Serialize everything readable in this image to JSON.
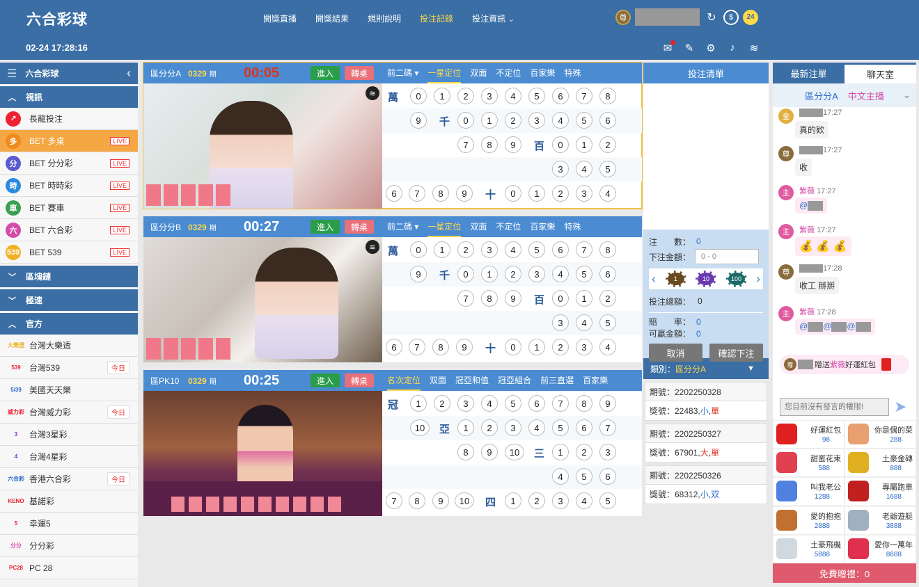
{
  "header": {
    "logo": "六合彩球",
    "datetime": "02-24 17:28:16",
    "nav": [
      "開獎直播",
      "開獎結果",
      "規則說明",
      "投注記錄",
      "投注資訊"
    ],
    "badge": "尊",
    "icon_24": "24"
  },
  "sidebar": {
    "title": "六合彩球",
    "sections": {
      "video": "視訊",
      "blockchain": "區塊鏈",
      "speed": "極速",
      "official": "官方"
    },
    "video_items": [
      {
        "label": "長龍投注",
        "icon": "",
        "color": "#e23"
      },
      {
        "label": "BET 多桌",
        "icon": "多",
        "color": "#f08a1c",
        "live": "LIVE"
      },
      {
        "label": "BET 分分彩",
        "icon": "分",
        "color": "#5a5ad0",
        "live": "LIVE"
      },
      {
        "label": "BET 時時彩",
        "icon": "時",
        "color": "#2a8ae0",
        "live": "LIVE"
      },
      {
        "label": "BET 賽車",
        "icon": "車",
        "color": "#3aa050",
        "live": "LIVE"
      },
      {
        "label": "BET 六合彩",
        "icon": "六",
        "color": "#d44ca8",
        "live": "LIVE"
      },
      {
        "label": "BET 539",
        "icon": "539",
        "color": "#f0b020",
        "live": "LIVE"
      }
    ],
    "official_items": [
      {
        "label": "台灣大樂透",
        "logo": "大樂透",
        "today": ""
      },
      {
        "label": "台灣539",
        "logo": "539",
        "today": "今日"
      },
      {
        "label": "美國天天樂",
        "logo": "5/39",
        "today": ""
      },
      {
        "label": "台灣威力彩",
        "logo": "威力彩",
        "today": "今日"
      },
      {
        "label": "台灣3星彩",
        "logo": "3",
        "today": ""
      },
      {
        "label": "台灣4星彩",
        "logo": "4",
        "today": ""
      },
      {
        "label": "香港六合彩",
        "logo": "六合彩",
        "today": "今日"
      },
      {
        "label": "基諾彩",
        "logo": "KENO",
        "today": ""
      },
      {
        "label": "幸運5",
        "logo": "5",
        "today": ""
      },
      {
        "label": "分分彩",
        "logo": "分分",
        "today": ""
      },
      {
        "label": "PC 28",
        "logo": "PC28",
        "today": ""
      }
    ]
  },
  "panels": [
    {
      "name": "區分分A",
      "period": "0329",
      "period_unit": "期",
      "timer": "00:05",
      "timer_red": true,
      "enter": "進入",
      "switch": "轉桌",
      "tabs": [
        "前二碼 ▾",
        "一星定位",
        "双面",
        "不定位",
        "百家樂",
        "特殊"
      ],
      "active_tab": 1
    },
    {
      "name": "區分分B",
      "period": "0329",
      "period_unit": "期",
      "timer": "00:27",
      "timer_red": false,
      "enter": "進入",
      "switch": "轉桌",
      "tabs": [
        "前二碼 ▾",
        "一星定位",
        "双面",
        "不定位",
        "百家樂",
        "特殊"
      ],
      "active_tab": 1
    },
    {
      "name": "區PK10",
      "period": "0329",
      "period_unit": "期",
      "timer": "00:25",
      "timer_red": false,
      "enter": "進入",
      "switch": "轉桌",
      "tabs": [
        "名次定位",
        "双面",
        "冠亞和值",
        "冠亞組合",
        "前三直選",
        "百家樂"
      ],
      "active_tab": 0
    }
  ],
  "lottery_grid_labels": [
    "萬",
    "千",
    "百",
    "十"
  ],
  "pk_grid_labels": [
    "冠",
    "亞",
    "三",
    "四"
  ],
  "betlist": {
    "title": "投注清單",
    "count_label": "注　　數：",
    "count": "0",
    "amount_label": "下注金額：",
    "amount_placeholder": "0 - 0",
    "chips": [
      "1",
      "10",
      "100"
    ],
    "total_label": "投注總額：",
    "total": "0",
    "odds_label": "賠　　率：",
    "odds": "0",
    "win_label": "可贏金額：",
    "win": "0",
    "cancel": "取消",
    "confirm": "確認下注",
    "category_label": "類別：",
    "category": "區分分A",
    "results": [
      {
        "period": "期號：2202250328",
        "prize": "獎號：22483,",
        "a": "小",
        "b": "單",
        "a_red": false,
        "b_red": true
      },
      {
        "period": "期號：2202250327",
        "prize": "獎號：67901,",
        "a": "大",
        "b": "單",
        "a_red": true,
        "b_red": true
      },
      {
        "period": "期號：2202250326",
        "prize": "獎號：68312,",
        "a": "小",
        "b": "双",
        "a_red": false,
        "b_red": false
      }
    ]
  },
  "chat": {
    "tabs": [
      "最新注單",
      "聊天室"
    ],
    "room": "區分分A",
    "lang": "中文主播",
    "messages": [
      {
        "badge": "金",
        "color": "#e0b040",
        "name": "",
        "time": "17:27",
        "text": "真的欵",
        "pink": false
      },
      {
        "badge": "尊",
        "color": "#8a6b3a",
        "name": "",
        "time": "17:27",
        "text": "收",
        "pink": false
      },
      {
        "badge": "主",
        "color": "#e05aa0",
        "name": "紫薇",
        "time": "17:27",
        "text": "@",
        "pink": true
      },
      {
        "badge": "主",
        "color": "#e05aa0",
        "name": "紫薇",
        "time": "17:27",
        "text": "",
        "pink": true
      },
      {
        "badge": "尊",
        "color": "#8a6b3a",
        "name": "",
        "time": "17:28",
        "text": "收工 掰掰",
        "pink": false
      },
      {
        "badge": "主",
        "color": "#e05aa0",
        "name": "紫薇",
        "time": "17:28",
        "text": "@  @  @",
        "pink": true
      }
    ],
    "gift_text_1": "贈送",
    "gift_name": "紫薇",
    "gift_text_2": "好運紅包",
    "input_placeholder": "您目前沒有發言的權限!",
    "gifts": [
      {
        "name": "好運紅包",
        "price": "98",
        "color": "#e02020"
      },
      {
        "name": "你是偶的菜",
        "price": "288",
        "color": "#e8a070"
      },
      {
        "name": "甜蜜花束",
        "price": "588",
        "color": "#e04050"
      },
      {
        "name": "土豪金磚",
        "price": "888",
        "color": "#e0b020"
      },
      {
        "name": "叫我老公",
        "price": "1288",
        "color": "#5080e0"
      },
      {
        "name": "專屬跑車",
        "price": "1688",
        "color": "#c02020"
      },
      {
        "name": "愛的抱抱",
        "price": "2888",
        "color": "#c07030"
      },
      {
        "name": "老爺遊艇",
        "price": "3888",
        "color": "#a0b0c0"
      },
      {
        "name": "土豪飛機",
        "price": "5888",
        "color": "#d0d8e0"
      },
      {
        "name": "愛你一萬年",
        "price": "8888",
        "color": "#e03050"
      }
    ],
    "free_gift": "免費贈禮：0"
  }
}
